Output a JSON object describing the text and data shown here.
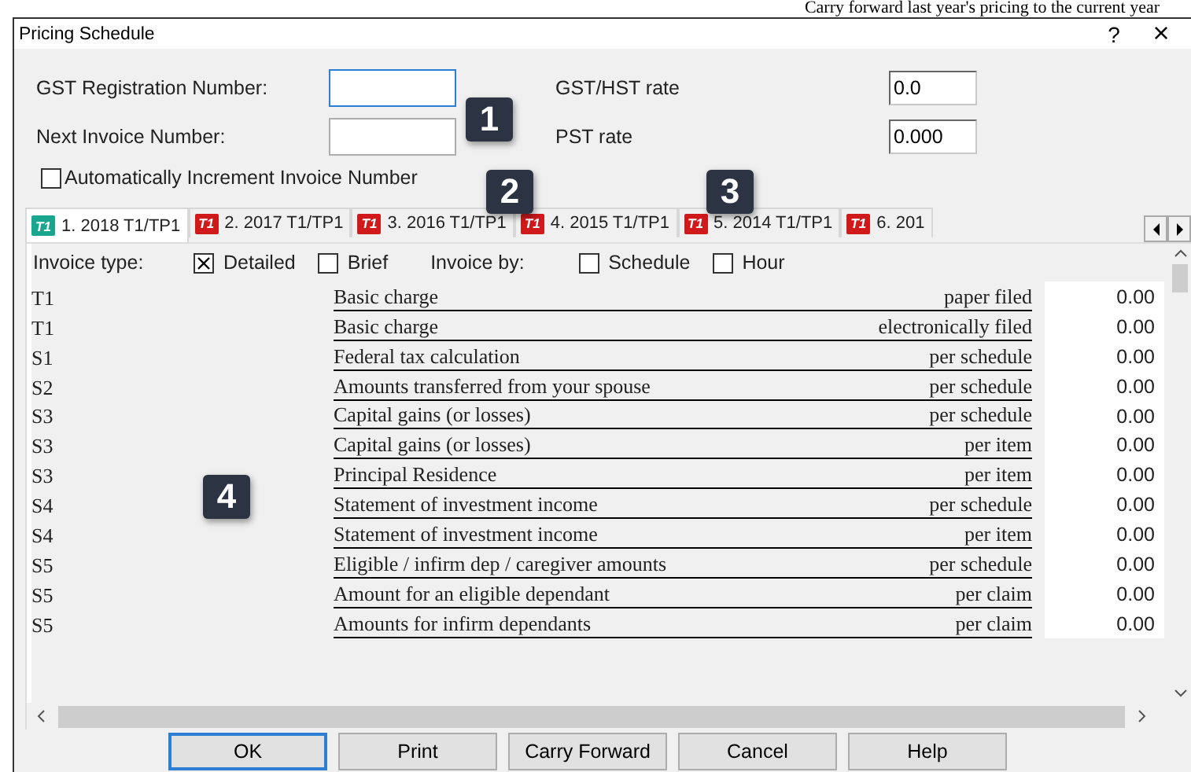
{
  "caption": "Carry forward last year's pricing to the current year",
  "window": {
    "title": "Pricing Schedule",
    "help": "?",
    "close": "×"
  },
  "fields": [
    {
      "label": "GST Registration Number:",
      "focused": true
    },
    {
      "label": "Next Invoice Number:",
      "focused": false
    }
  ],
  "rates": [
    {
      "label": "GST/HST rate",
      "value": "0.0"
    },
    {
      "label": "PST rate",
      "value": "0.000"
    }
  ],
  "auto_increment": {
    "label": "Automatically Increment Invoice Number",
    "checked": false
  },
  "tabs": [
    {
      "icon_text": "T1",
      "label": "1. 2018 T1/TP1",
      "selected": true,
      "color": "#1aa58f"
    },
    {
      "icon_text": "T1",
      "label": "2. 2017 T1/TP1",
      "selected": false,
      "color": "#d0191b"
    },
    {
      "icon_text": "T1",
      "label": "3. 2016 T1/TP1",
      "selected": false,
      "color": "#d0191b"
    },
    {
      "icon_text": "T1",
      "label": "4. 2015 T1/TP1",
      "selected": false,
      "color": "#d0191b"
    },
    {
      "icon_text": "T1",
      "label": "5. 2014 T1/TP1",
      "selected": false,
      "color": "#d0191b"
    },
    {
      "icon_text": "T1",
      "label": "6. 201",
      "selected": false,
      "color": "#d0191b"
    }
  ],
  "invoice_type": {
    "label": "Invoice type:",
    "options": [
      {
        "label": "Detailed",
        "checked": true
      },
      {
        "label": "Brief",
        "checked": false
      }
    ]
  },
  "invoice_by": {
    "label": "Invoice by:",
    "options": [
      {
        "label": "Schedule",
        "checked": false
      },
      {
        "label": "Hour",
        "checked": false
      }
    ]
  },
  "rows": [
    {
      "form": "T1",
      "item": "Basic charge",
      "unit": "paper filed",
      "price": "0.00"
    },
    {
      "form": "T1",
      "item": "Basic charge",
      "unit": "electronically filed",
      "price": "0.00"
    },
    {
      "form": "S1",
      "item": "Federal tax calculation",
      "unit": "per schedule",
      "price": "0.00"
    },
    {
      "form": "S2",
      "item": "Amounts transferred from your spouse",
      "unit": "per schedule",
      "price": "0.00"
    },
    {
      "form": "S3",
      "item": "Capital gains (or losses)",
      "unit": "per schedule",
      "price": "0.00"
    },
    {
      "form": "S3",
      "item": "Capital gains (or losses)",
      "unit": "per item",
      "price": "0.00"
    },
    {
      "form": "S3",
      "item": "Principal Residence",
      "unit": "per item",
      "price": "0.00"
    },
    {
      "form": "S4",
      "item": "Statement of investment income",
      "unit": "per schedule",
      "price": "0.00"
    },
    {
      "form": "S4",
      "item": "Statement of investment income",
      "unit": "per item",
      "price": "0.00"
    },
    {
      "form": "S5",
      "item": "Eligible / infirm dep / caregiver amounts",
      "unit": "per schedule",
      "price": "0.00"
    },
    {
      "form": "S5",
      "item": "Amount for an eligible dependant",
      "unit": "per claim",
      "price": "0.00"
    },
    {
      "form": "S5",
      "item": "Amounts for infirm dependants",
      "unit": "per claim",
      "price": "0.00"
    }
  ],
  "buttons": [
    {
      "label": "OK",
      "default": true
    },
    {
      "label": "Print",
      "default": false
    },
    {
      "label": "Carry Forward",
      "default": false
    },
    {
      "label": "Cancel",
      "default": false
    },
    {
      "label": "Help",
      "default": false
    }
  ],
  "callouts": [
    "1",
    "2",
    "3",
    "4"
  ]
}
